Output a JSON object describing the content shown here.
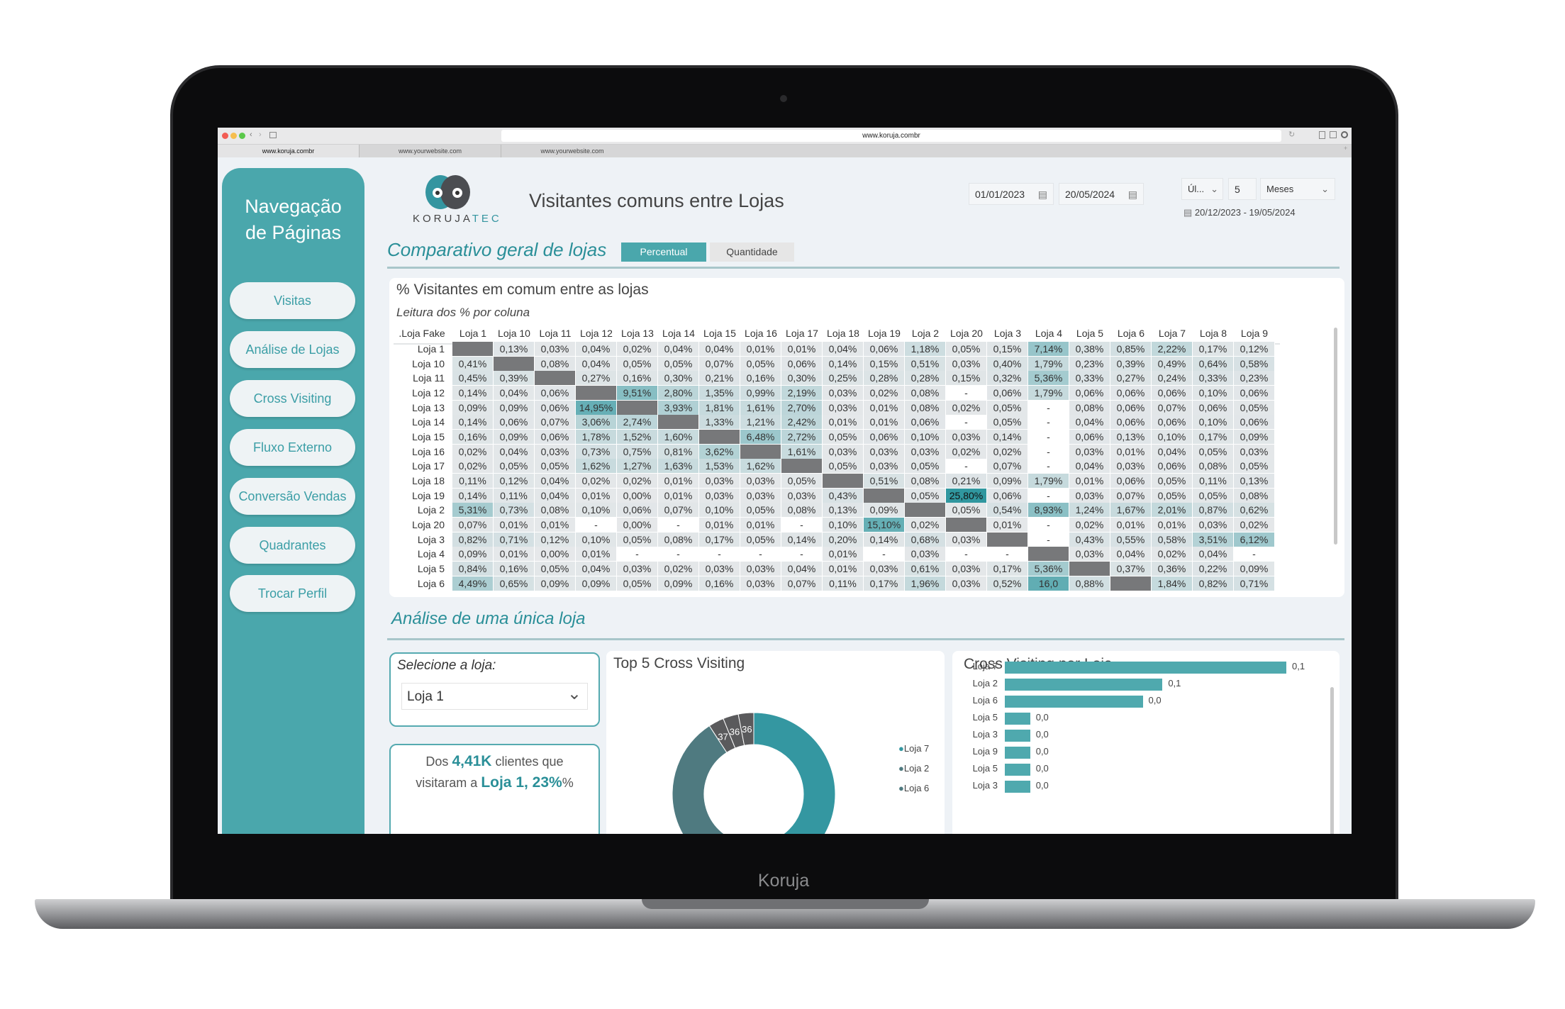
{
  "device": {
    "brand": "Koruja"
  },
  "browser": {
    "url": "www.koruja.combr",
    "tabs": [
      "www.koruja.combr",
      "www.yourwebsite.com",
      "www.yourwebsite.com"
    ],
    "close": "x",
    "new_tab": "+"
  },
  "sidebar": {
    "title_line1": "Navegação",
    "title_line2": "de Páginas",
    "items": [
      "Visitas",
      "Análise de Lojas",
      "Cross Visiting",
      "Fluxo Externo",
      "Conversão Vendas",
      "Quadrantes",
      "Trocar Perfil"
    ]
  },
  "header": {
    "logo_text_a": "KORUJA",
    "logo_text_b": "TEC",
    "title": "Visitantes comuns entre Lojas",
    "date_start": "01/01/2023",
    "date_end": "20/05/2024",
    "period_mode": "Úl...",
    "period_count": "5",
    "period_unit": "Meses",
    "range_text": "20/12/2023 - 19/05/2024"
  },
  "colors": {
    "teal": "#4aa7ac",
    "teal_text": "#2a8f98",
    "diag": "#77787a",
    "cell": "#e6e8ea",
    "dark_segment": "#555"
  },
  "section1": {
    "title": "Comparativo geral de lojas",
    "toggle": [
      "Percentual",
      "Quantidade"
    ],
    "active": "Percentual"
  },
  "matrix": {
    "title": "% Visitantes em comum entre as lojas",
    "subtitle": "Leitura dos % por coluna",
    "corner": ".Loja Fake",
    "columns": [
      "Loja 1",
      "Loja 10",
      "Loja 11",
      "Loja 12",
      "Loja 13",
      "Loja 14",
      "Loja 15",
      "Loja 16",
      "Loja 17",
      "Loja 18",
      "Loja 19",
      "Loja 2",
      "Loja 20",
      "Loja 3",
      "Loja 4",
      "Loja 5",
      "Loja 6",
      "Loja 7",
      "Loja 8",
      "Loja 9"
    ],
    "rows": [
      {
        "label": "Loja 1",
        "values": [
          "",
          "0,13%",
          "0,03%",
          "0,04%",
          "0,02%",
          "0,04%",
          "0,04%",
          "0,01%",
          "0,01%",
          "0,04%",
          "0,06%",
          "1,18%",
          "0,05%",
          "0,15%",
          "7,14%",
          "0,38%",
          "0,85%",
          "2,22%",
          "0,17%",
          "0,12%"
        ]
      },
      {
        "label": "Loja 10",
        "values": [
          "0,41%",
          "",
          "0,08%",
          "0,04%",
          "0,05%",
          "0,05%",
          "0,07%",
          "0,05%",
          "0,06%",
          "0,14%",
          "0,15%",
          "0,51%",
          "0,03%",
          "0,40%",
          "1,79%",
          "0,23%",
          "0,39%",
          "0,49%",
          "0,64%",
          "0,58%"
        ]
      },
      {
        "label": "Loja 11",
        "values": [
          "0,45%",
          "0,39%",
          "",
          "0,27%",
          "0,16%",
          "0,30%",
          "0,21%",
          "0,16%",
          "0,30%",
          "0,25%",
          "0,28%",
          "0,28%",
          "0,15%",
          "0,32%",
          "5,36%",
          "0,33%",
          "0,27%",
          "0,24%",
          "0,33%",
          "0,23%"
        ]
      },
      {
        "label": "Loja 12",
        "values": [
          "0,14%",
          "0,04%",
          "0,06%",
          "",
          "9,51%",
          "2,80%",
          "1,35%",
          "0,99%",
          "2,19%",
          "0,03%",
          "0,02%",
          "0,08%",
          "-",
          "0,06%",
          "1,79%",
          "0,06%",
          "0,06%",
          "0,06%",
          "0,10%",
          "0,06%"
        ]
      },
      {
        "label": "Loja 13",
        "values": [
          "0,09%",
          "0,09%",
          "0,06%",
          "14,95%",
          "",
          "3,93%",
          "1,81%",
          "1,61%",
          "2,70%",
          "0,03%",
          "0,01%",
          "0,08%",
          "0,02%",
          "0,05%",
          "-",
          "0,08%",
          "0,06%",
          "0,07%",
          "0,06%",
          "0,05%"
        ]
      },
      {
        "label": "Loja 14",
        "values": [
          "0,14%",
          "0,06%",
          "0,07%",
          "3,06%",
          "2,74%",
          "",
          "1,33%",
          "1,21%",
          "2,42%",
          "0,01%",
          "0,01%",
          "0,06%",
          "-",
          "0,05%",
          "-",
          "0,04%",
          "0,06%",
          "0,06%",
          "0,10%",
          "0,06%"
        ]
      },
      {
        "label": "Loja 15",
        "values": [
          "0,16%",
          "0,09%",
          "0,06%",
          "1,78%",
          "1,52%",
          "1,60%",
          "",
          "6,48%",
          "2,72%",
          "0,05%",
          "0,06%",
          "0,10%",
          "0,03%",
          "0,14%",
          "-",
          "0,06%",
          "0,13%",
          "0,10%",
          "0,17%",
          "0,09%"
        ]
      },
      {
        "label": "Loja 16",
        "values": [
          "0,02%",
          "0,04%",
          "0,03%",
          "0,73%",
          "0,75%",
          "0,81%",
          "3,62%",
          "",
          "1,61%",
          "0,03%",
          "0,03%",
          "0,03%",
          "0,02%",
          "0,02%",
          "-",
          "0,03%",
          "0,01%",
          "0,04%",
          "0,05%",
          "0,03%"
        ]
      },
      {
        "label": "Loja 17",
        "values": [
          "0,02%",
          "0,05%",
          "0,05%",
          "1,62%",
          "1,27%",
          "1,63%",
          "1,53%",
          "1,62%",
          "",
          "0,05%",
          "0,03%",
          "0,05%",
          "-",
          "0,07%",
          "-",
          "0,04%",
          "0,03%",
          "0,06%",
          "0,08%",
          "0,05%"
        ]
      },
      {
        "label": "Loja 18",
        "values": [
          "0,11%",
          "0,12%",
          "0,04%",
          "0,02%",
          "0,02%",
          "0,01%",
          "0,03%",
          "0,03%",
          "0,05%",
          "",
          "0,51%",
          "0,08%",
          "0,21%",
          "0,09%",
          "1,79%",
          "0,01%",
          "0,06%",
          "0,05%",
          "0,11%",
          "0,13%"
        ]
      },
      {
        "label": "Loja 19",
        "values": [
          "0,14%",
          "0,11%",
          "0,04%",
          "0,01%",
          "0,00%",
          "0,01%",
          "0,03%",
          "0,03%",
          "0,03%",
          "0,43%",
          "",
          "0,05%",
          "25,80%",
          "0,06%",
          "-",
          "0,03%",
          "0,07%",
          "0,05%",
          "0,05%",
          "0,08%"
        ]
      },
      {
        "label": "Loja 2",
        "values": [
          "5,31%",
          "0,73%",
          "0,08%",
          "0,10%",
          "0,06%",
          "0,07%",
          "0,10%",
          "0,05%",
          "0,08%",
          "0,13%",
          "0,09%",
          "",
          "0,05%",
          "0,54%",
          "8,93%",
          "1,24%",
          "1,67%",
          "2,01%",
          "0,87%",
          "0,62%"
        ]
      },
      {
        "label": "Loja 20",
        "values": [
          "0,07%",
          "0,01%",
          "0,01%",
          "-",
          "0,00%",
          "-",
          "0,01%",
          "0,01%",
          "-",
          "0,10%",
          "15,10%",
          "0,02%",
          "",
          "0,01%",
          "-",
          "0,02%",
          "0,01%",
          "0,01%",
          "0,03%",
          "0,02%"
        ]
      },
      {
        "label": "Loja 3",
        "values": [
          "0,82%",
          "0,71%",
          "0,12%",
          "0,10%",
          "0,05%",
          "0,08%",
          "0,17%",
          "0,05%",
          "0,14%",
          "0,20%",
          "0,14%",
          "0,68%",
          "0,03%",
          "",
          "-",
          "0,43%",
          "0,55%",
          "0,58%",
          "3,51%",
          "6,12%"
        ]
      },
      {
        "label": "Loja 4",
        "values": [
          "0,09%",
          "0,01%",
          "0,00%",
          "0,01%",
          "-",
          "-",
          "-",
          "-",
          "-",
          "0,01%",
          "-",
          "0,03%",
          "-",
          "-",
          "",
          "0,03%",
          "0,04%",
          "0,02%",
          "0,04%",
          "-"
        ]
      },
      {
        "label": "Loja 5",
        "values": [
          "0,84%",
          "0,16%",
          "0,05%",
          "0,04%",
          "0,03%",
          "0,02%",
          "0,03%",
          "0,03%",
          "0,04%",
          "0,01%",
          "0,03%",
          "0,61%",
          "0,03%",
          "0,17%",
          "5,36%",
          "",
          "0,37%",
          "0,36%",
          "0,22%",
          "0,09%"
        ]
      },
      {
        "label": "Loja 6",
        "values": [
          "4,49%",
          "0,65%",
          "0,09%",
          "0,09%",
          "0,05%",
          "0,09%",
          "0,16%",
          "0,03%",
          "0,07%",
          "0,11%",
          "0,17%",
          "1,96%",
          "0,03%",
          "0,52%",
          "16,0",
          "0,88%",
          "",
          "1,84%",
          "0,82%",
          "0,71%"
        ]
      }
    ]
  },
  "section2": {
    "title": "Análise de uma única loja"
  },
  "store_select": {
    "label": "Selecione a loja:",
    "value": "Loja 1"
  },
  "summary": {
    "p1": "Dos ",
    "total": "4,41K",
    "p2": " clientes que visitaram a ",
    "store": "Loja 1",
    "sep": ", ",
    "pct": "23%",
    "p3": "%"
  },
  "top5": {
    "title": "Top 5 Cross Visiting",
    "legend": [
      "Loja 7",
      "Loja 2",
      "Loja 6"
    ],
    "legend_colors": [
      "#3497a1",
      "#4f7a80",
      "#4f7a80"
    ],
    "segment_labels": [
      "37",
      "36",
      "36"
    ]
  },
  "chart_data": {
    "type": "bar",
    "title": "Cross Visiting por Loja",
    "categories": [
      "Loja 7",
      "Loja 2",
      "Loja 6",
      "Loja 5",
      "Loja 3",
      "Loja 9",
      "Loja 5",
      "Loja 3"
    ],
    "values": [
      0.1,
      0.1,
      0.0,
      0.0,
      0.0,
      0.0,
      0.0,
      0.0
    ],
    "labels": [
      "0,1",
      "0,1",
      "0,0",
      "0,0",
      "0,0",
      "0,0",
      "0,0",
      "0,0"
    ],
    "relative_lengths": [
      1.0,
      0.56,
      0.49,
      0.09,
      0.09,
      0.09,
      0.09,
      0.09
    ],
    "color": "#4fa9ae",
    "orientation": "horizontal"
  }
}
